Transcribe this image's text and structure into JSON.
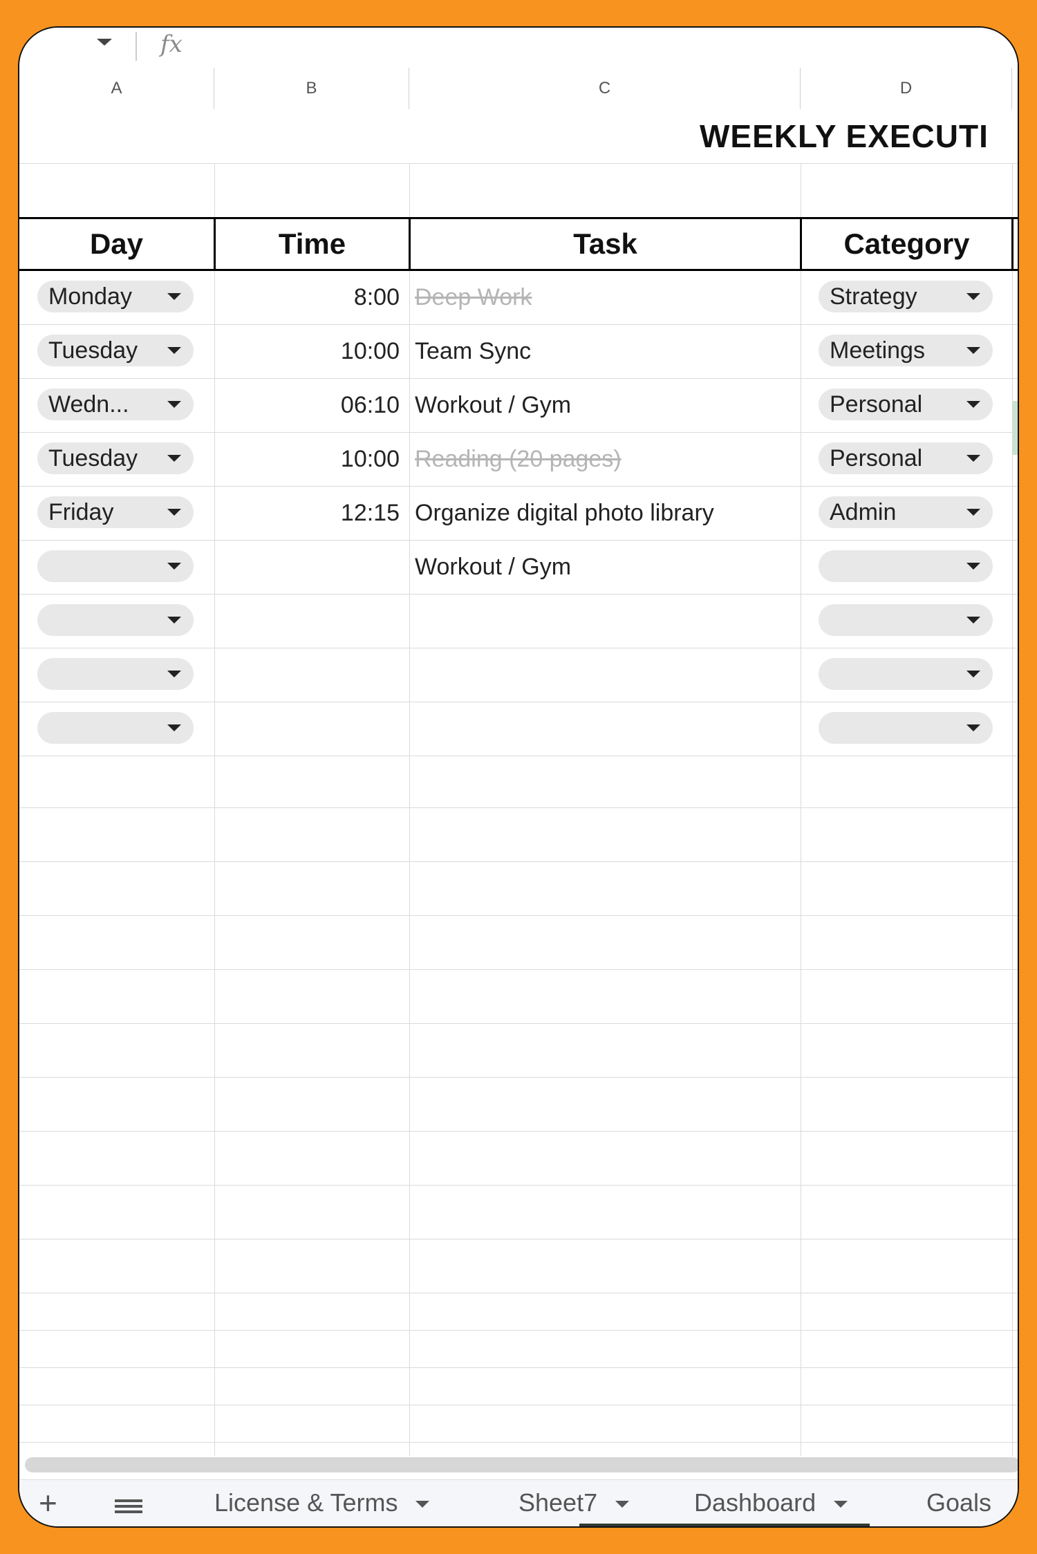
{
  "formula_bar": {
    "fx_label": "fx"
  },
  "columns": [
    "A",
    "B",
    "C",
    "D"
  ],
  "sheet": {
    "title": "WEEKLY EXECUTI",
    "headers": {
      "day": "Day",
      "time": "Time",
      "task": "Task",
      "category": "Category"
    },
    "rows": [
      {
        "day": "Monday",
        "time": "8:00",
        "task": "Deep Work",
        "task_done": true,
        "category": "Strategy"
      },
      {
        "day": "Tuesday",
        "time": "10:00",
        "task": "Team Sync",
        "task_done": false,
        "category": "Meetings"
      },
      {
        "day": "Wedn...",
        "time": "06:10",
        "task": "Workout / Gym",
        "task_done": false,
        "category": "Personal"
      },
      {
        "day": "Tuesday",
        "time": "10:00",
        "task": "Reading (20 pages)",
        "task_done": true,
        "category": "Personal"
      },
      {
        "day": "Friday",
        "time": "12:15",
        "task": "Organize digital photo library",
        "task_done": false,
        "category": "Admin"
      },
      {
        "day": "",
        "time": "",
        "task": "Workout / Gym",
        "task_done": false,
        "category": ""
      },
      {
        "day": "",
        "time": "",
        "task": "",
        "task_done": false,
        "category": ""
      },
      {
        "day": "",
        "time": "",
        "task": "",
        "task_done": false,
        "category": ""
      },
      {
        "day": "",
        "time": "",
        "task": "",
        "task_done": false,
        "category": ""
      }
    ]
  },
  "tabs": [
    "License & Terms",
    "Sheet7",
    "Dashboard",
    "Goals"
  ],
  "colors": {
    "frame": "#f7931e",
    "chip": "#e8e8e8",
    "done_text": "#b5b5b5"
  }
}
